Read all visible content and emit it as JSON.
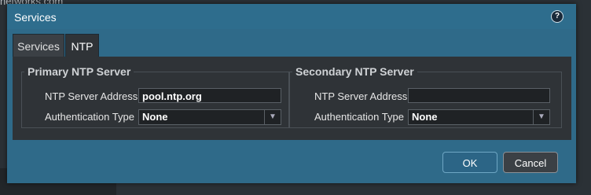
{
  "background": {
    "partial_text": "networks.com"
  },
  "dialog": {
    "title": "Services",
    "help_icon": "help-icon"
  },
  "tabs": [
    {
      "label": "Services",
      "active": false
    },
    {
      "label": "NTP",
      "active": true
    }
  ],
  "primary": {
    "legend": "Primary NTP Server",
    "address_label": "NTP Server Address",
    "address_value": "pool.ntp.org",
    "auth_label": "Authentication Type",
    "auth_value": "None"
  },
  "secondary": {
    "legend": "Secondary NTP Server",
    "address_label": "NTP Server Address",
    "address_value": "",
    "auth_label": "Authentication Type",
    "auth_value": "None"
  },
  "buttons": {
    "ok": "OK",
    "cancel": "Cancel"
  },
  "colors": {
    "titlebar": "#2e6d8d",
    "ok_button": "#2c6586",
    "panel": "#2f3337"
  }
}
